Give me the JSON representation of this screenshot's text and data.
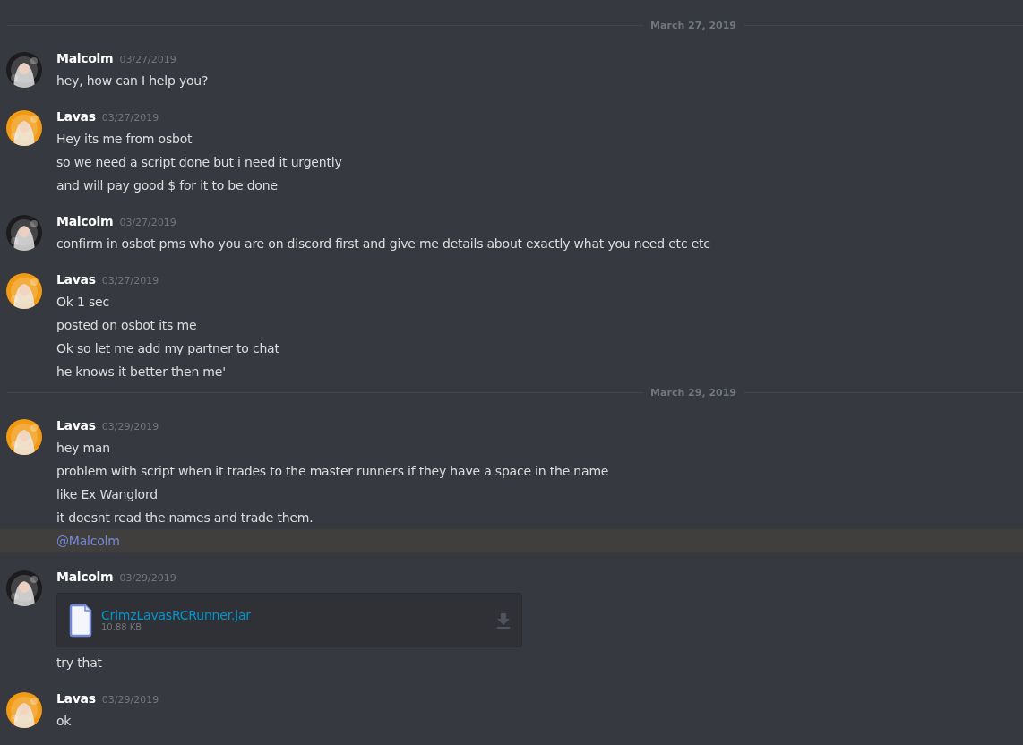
{
  "messages": [
    {
      "kind": "divider",
      "label": "March 27, 2019"
    },
    {
      "kind": "group",
      "author": "Malcolm",
      "avatar": {
        "kind": "picture",
        "color": "#1c1c1e"
      },
      "timestamp": "03/27/2019",
      "lines": [
        {
          "kind": "text",
          "text": "hey, how can I help you?"
        }
      ]
    },
    {
      "kind": "group",
      "author": "Lavas",
      "avatar": {
        "kind": "picture",
        "color": "#f19a14"
      },
      "timestamp": "03/27/2019",
      "lines": [
        {
          "kind": "text",
          "text": "Hey its me from osbot"
        },
        {
          "kind": "text",
          "text": "so we need a script done but i need it urgently"
        },
        {
          "kind": "text",
          "text": "and will pay good $ for it to be done"
        }
      ]
    },
    {
      "kind": "group",
      "author": "Malcolm",
      "avatar": {
        "kind": "picture",
        "color": "#1c1c1e"
      },
      "timestamp": "03/27/2019",
      "lines": [
        {
          "kind": "text",
          "text": "confirm in osbot pms who you are on discord first and give me details about exactly what you need etc etc"
        }
      ]
    },
    {
      "kind": "group",
      "author": "Lavas",
      "avatar": {
        "kind": "picture",
        "color": "#f19a14"
      },
      "timestamp": "03/27/2019",
      "lines": [
        {
          "kind": "text",
          "text": "Ok 1 sec"
        },
        {
          "kind": "text",
          "text": "posted on osbot its me"
        },
        {
          "kind": "text",
          "text": "Ok so let me add my partner to chat"
        },
        {
          "kind": "text",
          "text": "he knows it better then me'"
        }
      ]
    },
    {
      "kind": "divider",
      "label": "March 29, 2019"
    },
    {
      "kind": "group",
      "author": "Lavas",
      "avatar": {
        "kind": "picture",
        "color": "#f19a14"
      },
      "timestamp": "03/29/2019",
      "lines": [
        {
          "kind": "text",
          "text": "hey man"
        },
        {
          "kind": "text",
          "text": "problem with script when it trades to the master runners if they have a space in the name"
        },
        {
          "kind": "text",
          "text": "like Ex Wanglord"
        },
        {
          "kind": "text",
          "text": "it doesnt read the names and trade them."
        },
        {
          "kind": "mention",
          "text": "@Malcolm"
        }
      ]
    },
    {
      "kind": "group",
      "author": "Malcolm",
      "avatar": {
        "kind": "picture",
        "color": "#1c1c1e"
      },
      "timestamp": "03/29/2019",
      "lines": [
        {
          "kind": "attachment",
          "filename": "CrimzLavasRCRunner.jar",
          "size": "10.88 KB"
        },
        {
          "kind": "text",
          "text": "try that"
        }
      ]
    },
    {
      "kind": "group",
      "author": "Lavas",
      "avatar": {
        "kind": "picture",
        "color": "#f19a14"
      },
      "timestamp": "03/29/2019",
      "lines": [
        {
          "kind": "text",
          "text": "ok"
        }
      ]
    }
  ]
}
